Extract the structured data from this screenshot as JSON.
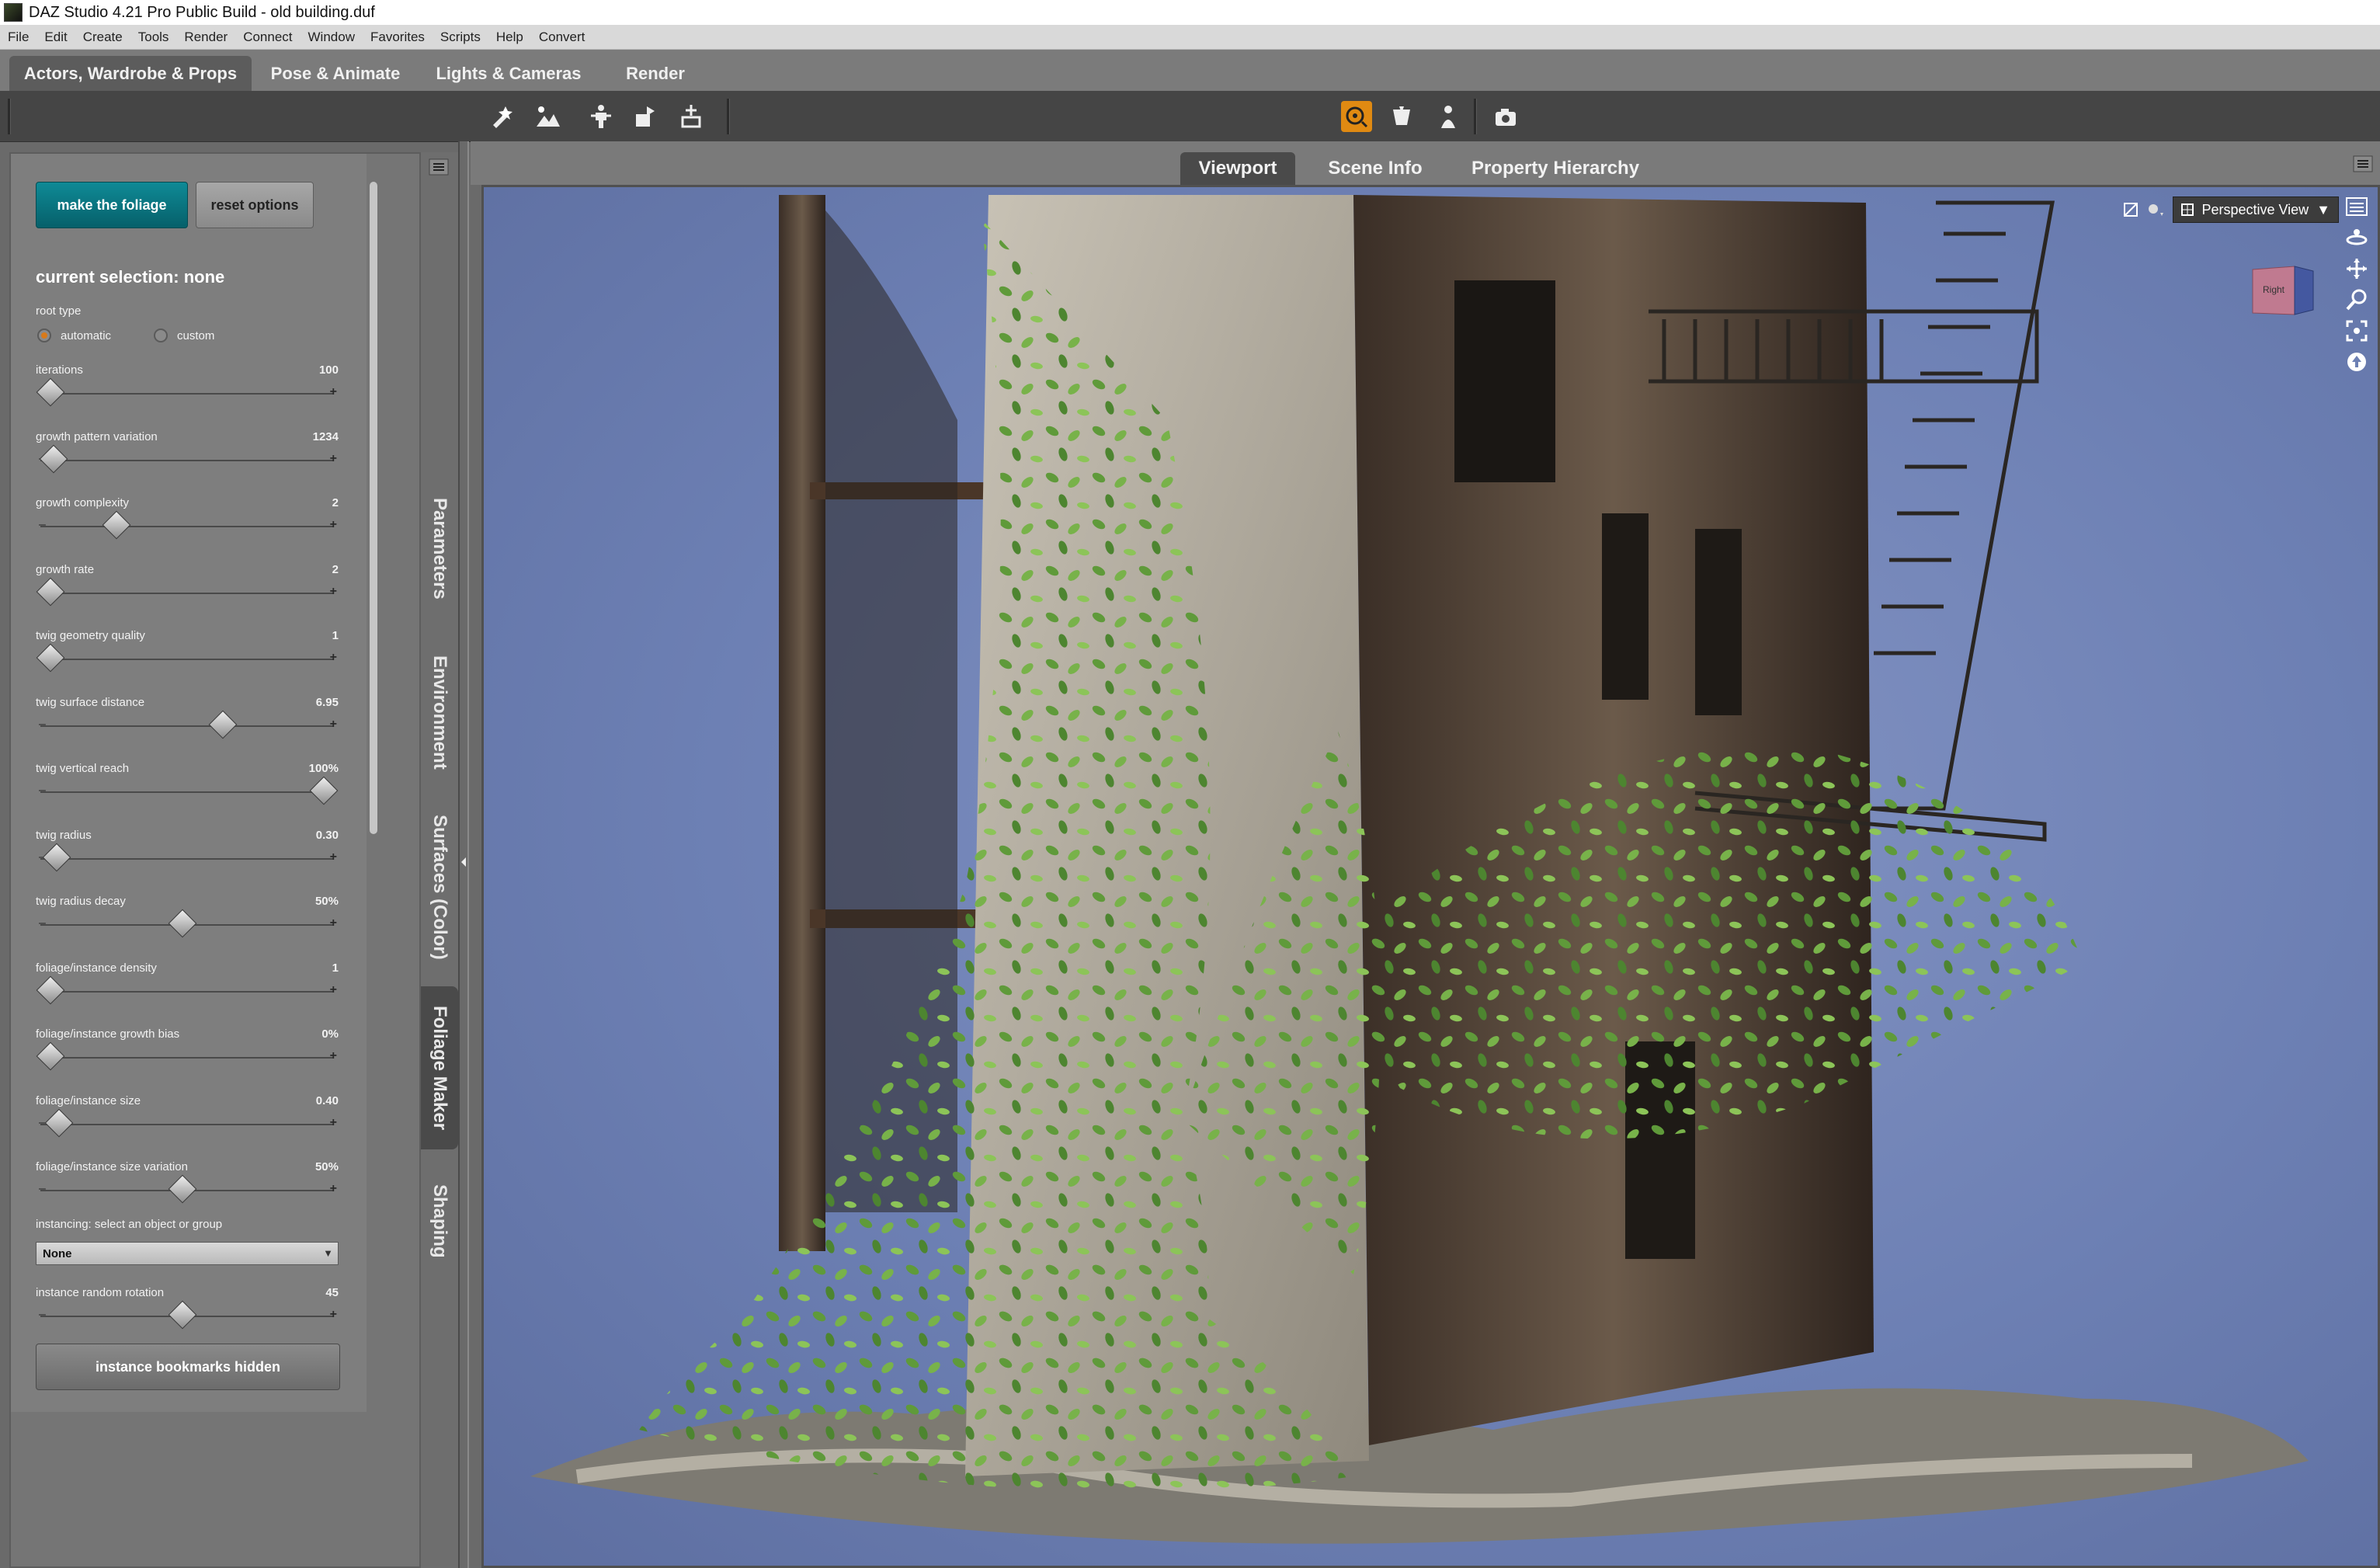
{
  "window": {
    "title": "DAZ Studio 4.21 Pro Public Build - old building.duf"
  },
  "menu": [
    "File",
    "Edit",
    "Create",
    "Tools",
    "Render",
    "Connect",
    "Window",
    "Favorites",
    "Scripts",
    "Help",
    "Convert"
  ],
  "rooms": [
    "Actors, Wardrobe & Props",
    "Pose & Animate",
    "Lights & Cameras",
    "Render"
  ],
  "toolbar": {
    "icons": [
      "node-selection-icon",
      "surface-selection-icon",
      "joint-editor-icon",
      "transform-icon",
      "geometry-editor-icon",
      "render-settings-icon",
      "render-icon",
      "figure-setup-icon",
      "camera-icon"
    ],
    "active_color": "#e08a12"
  },
  "foliage": {
    "make_button": "make the foliage",
    "reset_button": "reset options",
    "selection_title": "current selection: none",
    "root_type": {
      "label": "root type",
      "options": [
        "automatic",
        "custom"
      ],
      "selected": "automatic"
    },
    "sliders": [
      {
        "name": "iterations",
        "value": "100",
        "level": 0.03
      },
      {
        "name": "growth pattern variation",
        "value": "1234",
        "level": 0.04
      },
      {
        "name": "growth complexity",
        "value": "2",
        "level": 0.26
      },
      {
        "name": "growth rate",
        "value": "2",
        "level": 0.03
      },
      {
        "name": "twig geometry quality",
        "value": "1",
        "level": 0.03
      },
      {
        "name": "twig surface distance",
        "value": "6.95",
        "level": 0.63
      },
      {
        "name": "twig vertical reach",
        "value": "100%",
        "level": 0.98
      },
      {
        "name": "twig radius",
        "value": "0.30",
        "level": 0.05
      },
      {
        "name": "twig radius decay",
        "value": "50%",
        "level": 0.49
      },
      {
        "name": "foliage/instance density",
        "value": "1",
        "level": 0.03
      },
      {
        "name": "foliage/instance growth bias",
        "value": "0%",
        "level": 0.03
      },
      {
        "name": "foliage/instance size",
        "value": "0.40",
        "level": 0.06
      },
      {
        "name": "foliage/instance size variation",
        "value": "50%",
        "level": 0.49
      }
    ],
    "instancing": {
      "label": "instancing: select an object or group",
      "selected": "None"
    },
    "rotation": {
      "name": "instance random rotation",
      "value": "45",
      "level": 0.49
    },
    "bookmarks_button": "instance bookmarks hidden"
  },
  "side_tabs": [
    "Parameters",
    "Environment",
    "Surfaces (Color)",
    "Foliage Maker",
    "Shaping"
  ],
  "side_tabs_active": "Foliage Maker",
  "viewport": {
    "tabs": [
      "Viewport",
      "Scene Info",
      "Property Hierarchy"
    ],
    "active_tab": "Viewport",
    "view_name": "Perspective View",
    "cube_label": "Right",
    "background": "#7486b9"
  }
}
